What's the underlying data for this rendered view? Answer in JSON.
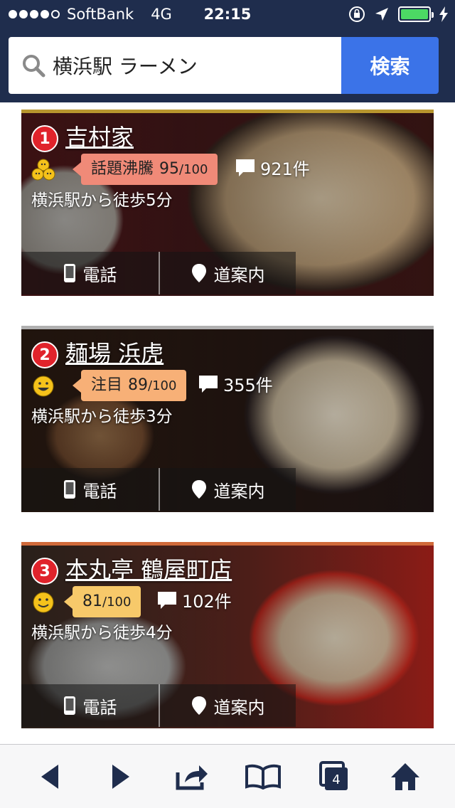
{
  "status_bar": {
    "carrier": "SoftBank",
    "network": "4G",
    "time": "22:15"
  },
  "search": {
    "query": "横浜駅 ラーメン",
    "button_label": "検索"
  },
  "results": [
    {
      "rank": "1",
      "name": "吉村家",
      "badge_label": "話題沸騰",
      "score": "95",
      "max": "/100",
      "comments": "921件",
      "access": "横浜駅から徒歩5分",
      "call_label": "電話",
      "directions_label": "道案内",
      "accent_color": "#f08a78",
      "line_color": "#b8962e",
      "face_icon": "buzzing-faces-icon"
    },
    {
      "rank": "2",
      "name": "麺場 浜虎",
      "badge_label": "注目",
      "score": "89",
      "max": "/100",
      "comments": "355件",
      "access": "横浜駅から徒歩3分",
      "call_label": "電話",
      "directions_label": "道案内",
      "accent_color": "#f7b077",
      "line_color": "#b0b0b0",
      "face_icon": "grinning-face-icon"
    },
    {
      "rank": "3",
      "name": "本丸亭 鶴屋町店",
      "badge_label": "",
      "score": "81",
      "max": "/100",
      "comments": "102件",
      "access": "横浜駅から徒歩4分",
      "call_label": "電話",
      "directions_label": "道案内",
      "accent_color": "#f7c96a",
      "line_color": "#d06a3a",
      "face_icon": "smiling-face-icon"
    }
  ],
  "toolbar": {
    "tabs_count": "4"
  }
}
